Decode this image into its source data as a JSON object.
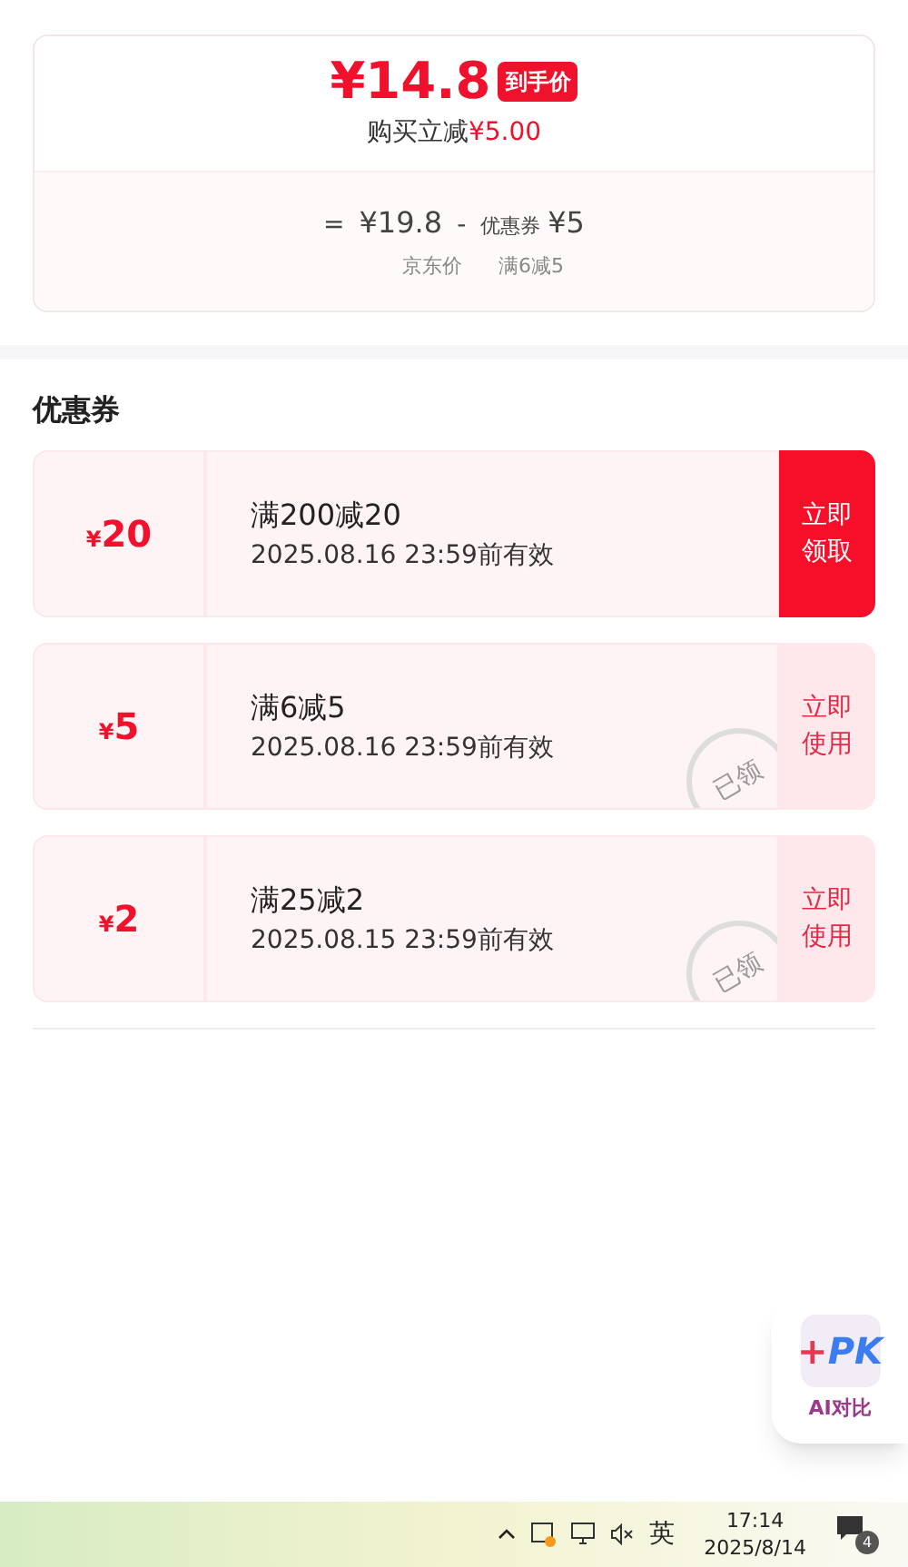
{
  "price_card": {
    "price": "¥14.8",
    "badge": "到手价",
    "saving_label": "购买立减",
    "saving_amount": "¥5.00",
    "equals": "=",
    "original_price": "¥19.8",
    "minus": "-",
    "coupon_label": "优惠券",
    "coupon_amount": "¥5",
    "original_caption": "京东价",
    "coupon_caption": "满6减5"
  },
  "coupons_section": {
    "title": "优惠券",
    "coupons": [
      {
        "currency": "¥",
        "amount": "20",
        "rule": "满200减20",
        "validity": "2025.08.16 23:59前有效",
        "action": "立即领取",
        "claimed": false
      },
      {
        "currency": "¥",
        "amount": "5",
        "rule": "满6减5",
        "validity": "2025.08.16 23:59前有效",
        "action": "立即使用",
        "claimed": true,
        "stamp": "已领"
      },
      {
        "currency": "¥",
        "amount": "2",
        "rule": "满25减2",
        "validity": "2025.08.15 23:59前有效",
        "action": "立即使用",
        "claimed": true,
        "stamp": "已领"
      }
    ]
  },
  "ai_compare": {
    "logo_plus": "+",
    "logo_pk": "PK",
    "label": "AI对比"
  },
  "taskbar": {
    "ime": "英",
    "time": "17:14",
    "date": "2025/8/14",
    "notifications": "4"
  }
}
